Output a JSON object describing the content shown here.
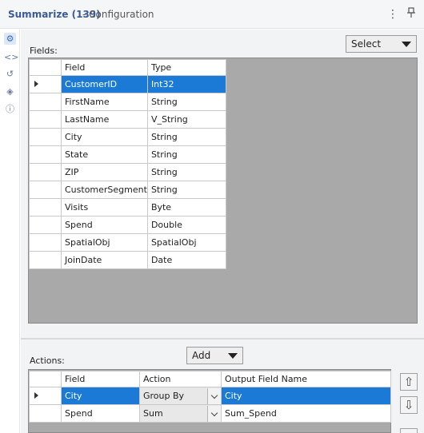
{
  "header": {
    "title": "Summarize (139)",
    "subtitle": "- Configuration",
    "menu_icon": "kebab-menu-icon",
    "pin_icon": "pin-icon"
  },
  "sidebar": {
    "icons": [
      "gear-icon",
      "code-icon",
      "arrows-icon",
      "tag-icon",
      "help-icon"
    ]
  },
  "fields_panel": {
    "label": "Fields:",
    "select_button": "Select",
    "columns": [
      "Field",
      "Type"
    ],
    "rows": [
      {
        "field": "CustomerID",
        "type": "Int32"
      },
      {
        "field": "FirstName",
        "type": "String"
      },
      {
        "field": "LastName",
        "type": "V_String"
      },
      {
        "field": "City",
        "type": "String"
      },
      {
        "field": "State",
        "type": "String"
      },
      {
        "field": "ZIP",
        "type": "String"
      },
      {
        "field": "CustomerSegment",
        "type": "String"
      },
      {
        "field": "Visits",
        "type": "Byte"
      },
      {
        "field": "Spend",
        "type": "Double"
      },
      {
        "field": "SpatialObj",
        "type": "SpatialObj"
      },
      {
        "field": "JoinDate",
        "type": "Date"
      }
    ],
    "selected_row": 0
  },
  "actions_panel": {
    "label": "Actions:",
    "add_button": "Add",
    "columns": [
      "Field",
      "Action",
      "Output Field Name"
    ],
    "rows": [
      {
        "field": "City",
        "action": "Group By",
        "output": "City"
      },
      {
        "field": "Spend",
        "action": "Sum",
        "output": "Sum_Spend"
      }
    ],
    "selected_row": 0,
    "move_up_icon": "arrow-up-icon",
    "move_down_icon": "arrow-down-icon"
  },
  "colors": {
    "selection": "#1a7ad6",
    "title": "#3a5a98",
    "grid_background": "#a9a9a9"
  }
}
